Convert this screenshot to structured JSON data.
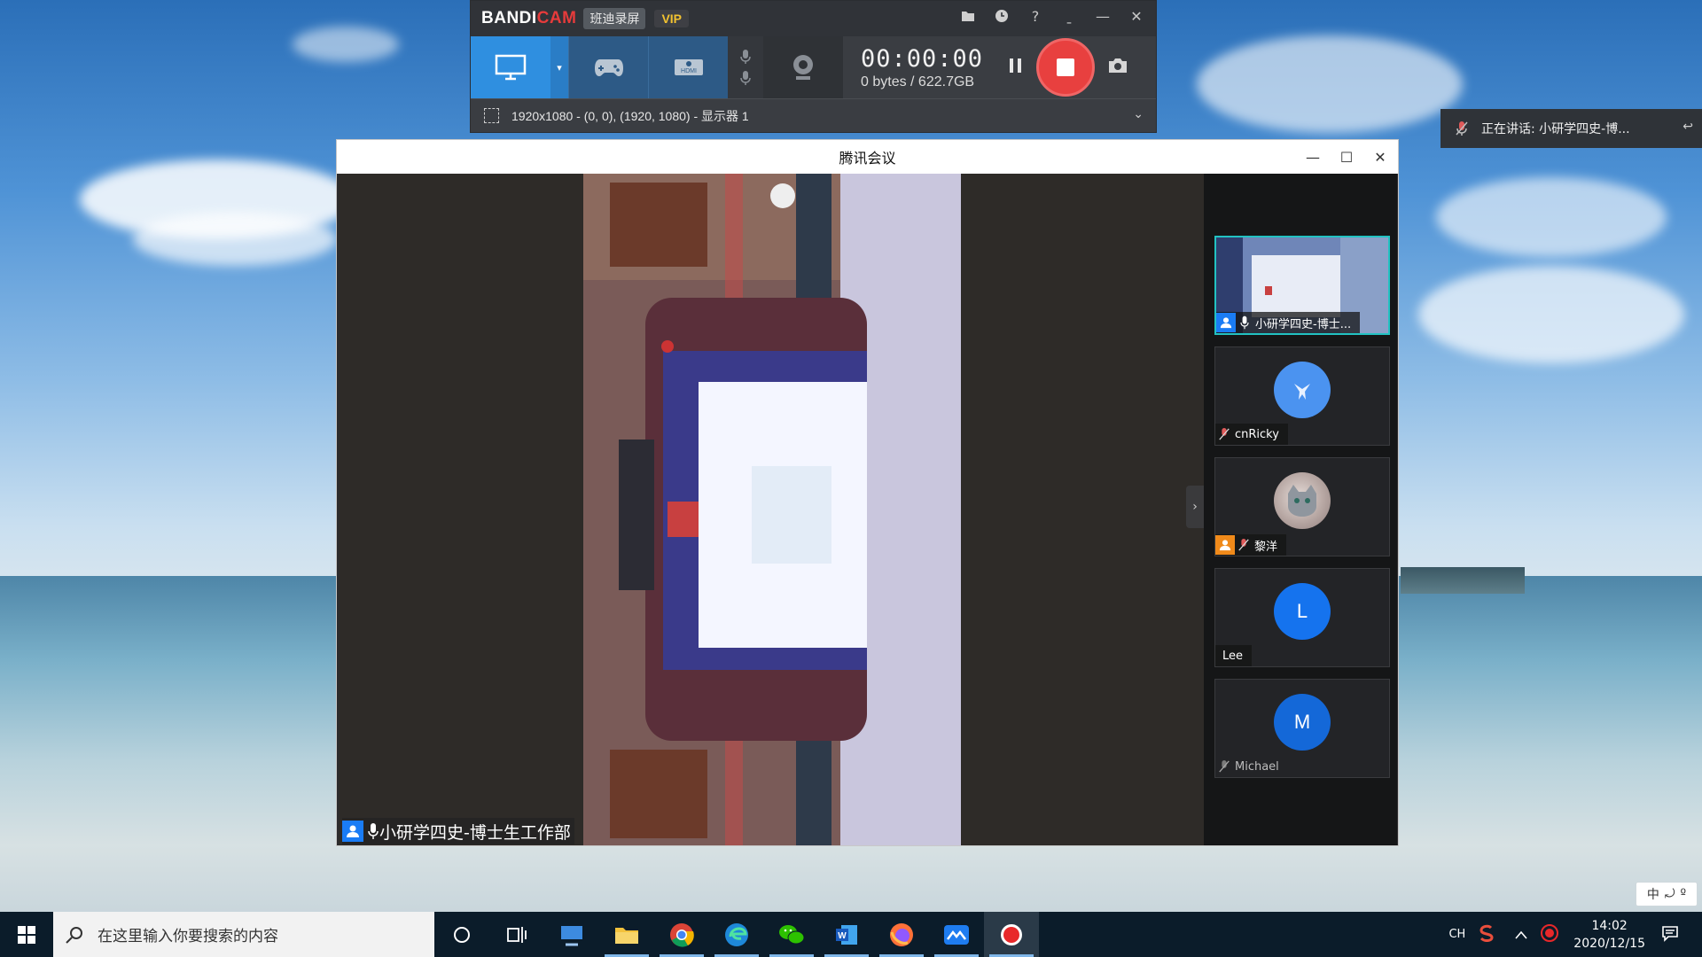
{
  "bandicam": {
    "logo_part1": "BANDI",
    "logo_part2": "CAM",
    "edition_label": "班迪录屏",
    "vip_label": "VIP",
    "timer": "00:00:00",
    "file_size": "0 bytes / 622.7GB",
    "capture_region": "1920x1080 - (0, 0), (1920, 1080) - 显示器 1",
    "modes": [
      "screen-recording-icon",
      "game-recording-icon",
      "hdmi-recording-icon"
    ]
  },
  "notification": {
    "speaking_text": "正在讲话: 小研学四史-博..."
  },
  "meeting": {
    "window_title": "腾讯会议",
    "main_speaker_name": "小研学四史-博士生工作部",
    "participants": [
      {
        "name": "小研学四史-博士...",
        "avatar_letter": "",
        "avatar_color": "#1a7cf5",
        "muted": false,
        "has_video": true
      },
      {
        "name": "cnRicky",
        "avatar_letter": "",
        "avatar_color": "#4b93f0",
        "muted": true,
        "has_video": false
      },
      {
        "name": "黎洋",
        "avatar_letter": "",
        "avatar_color": "#c9b6b0",
        "muted": true,
        "has_video": false
      },
      {
        "name": "Lee",
        "avatar_letter": "L",
        "avatar_color": "#1573ee",
        "muted": false,
        "has_video": false
      },
      {
        "name": "Michael",
        "avatar_letter": "M",
        "avatar_color": "#1468d8",
        "muted": true,
        "has_video": false
      }
    ]
  },
  "ime": {
    "lang": "中",
    "mode": "⤾",
    "extra": "º"
  },
  "taskbar": {
    "search_placeholder": "在这里输入你要搜索的内容",
    "lang_indicator": "CH",
    "time": "14:02",
    "date": "2020/12/15"
  },
  "colors": {
    "bandicam_active": "#2f8fe0",
    "record_red": "#e8403f",
    "tencent_blue": "#1a7cf5",
    "active_tile_border": "#22c2c2"
  }
}
